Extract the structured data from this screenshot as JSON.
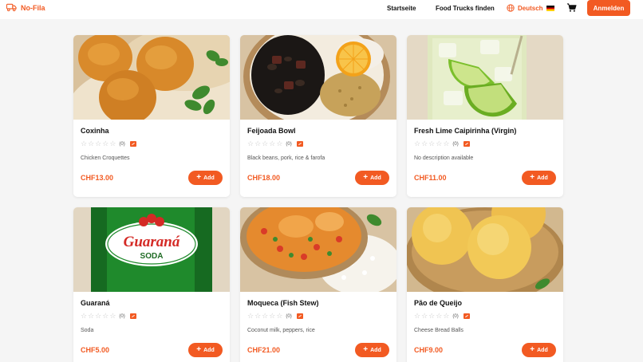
{
  "header": {
    "brand": "No-Fila",
    "nav": [
      "Startseite",
      "Food Trucks finden"
    ],
    "language": "Deutsch",
    "login_label": "Anmelden"
  },
  "colors": {
    "accent": "#f25a22",
    "background": "#f5f5f5"
  },
  "products": [
    {
      "name": "Coxinha",
      "rating_count": "(0)",
      "description": "Chicken Croquettes",
      "price": "CHF13.00",
      "add_label": "Add"
    },
    {
      "name": "Feijoada Bowl",
      "rating_count": "(0)",
      "description": "Black beans, pork, rice & farofa",
      "price": "CHF18.00",
      "add_label": "Add"
    },
    {
      "name": "Fresh Lime Caipirinha (Virgin)",
      "rating_count": "(0)",
      "description": "No description available",
      "price": "CHF11.00",
      "add_label": "Add"
    },
    {
      "name": "Guaraná",
      "rating_count": "(0)",
      "description": "Soda",
      "price": "CHF5.00",
      "add_label": "Add"
    },
    {
      "name": "Moqueca (Fish Stew)",
      "rating_count": "(0)",
      "description": "Coconut milk, peppers, rice",
      "price": "CHF21.00",
      "add_label": "Add"
    },
    {
      "name": "Pão de Queijo",
      "rating_count": "(0)",
      "description": "Cheese Bread Balls",
      "price": "CHF9.00",
      "add_label": "Add"
    }
  ],
  "images": {
    "guarana_can_text_1": "Guaraná",
    "guarana_can_text_2": "SODA"
  }
}
